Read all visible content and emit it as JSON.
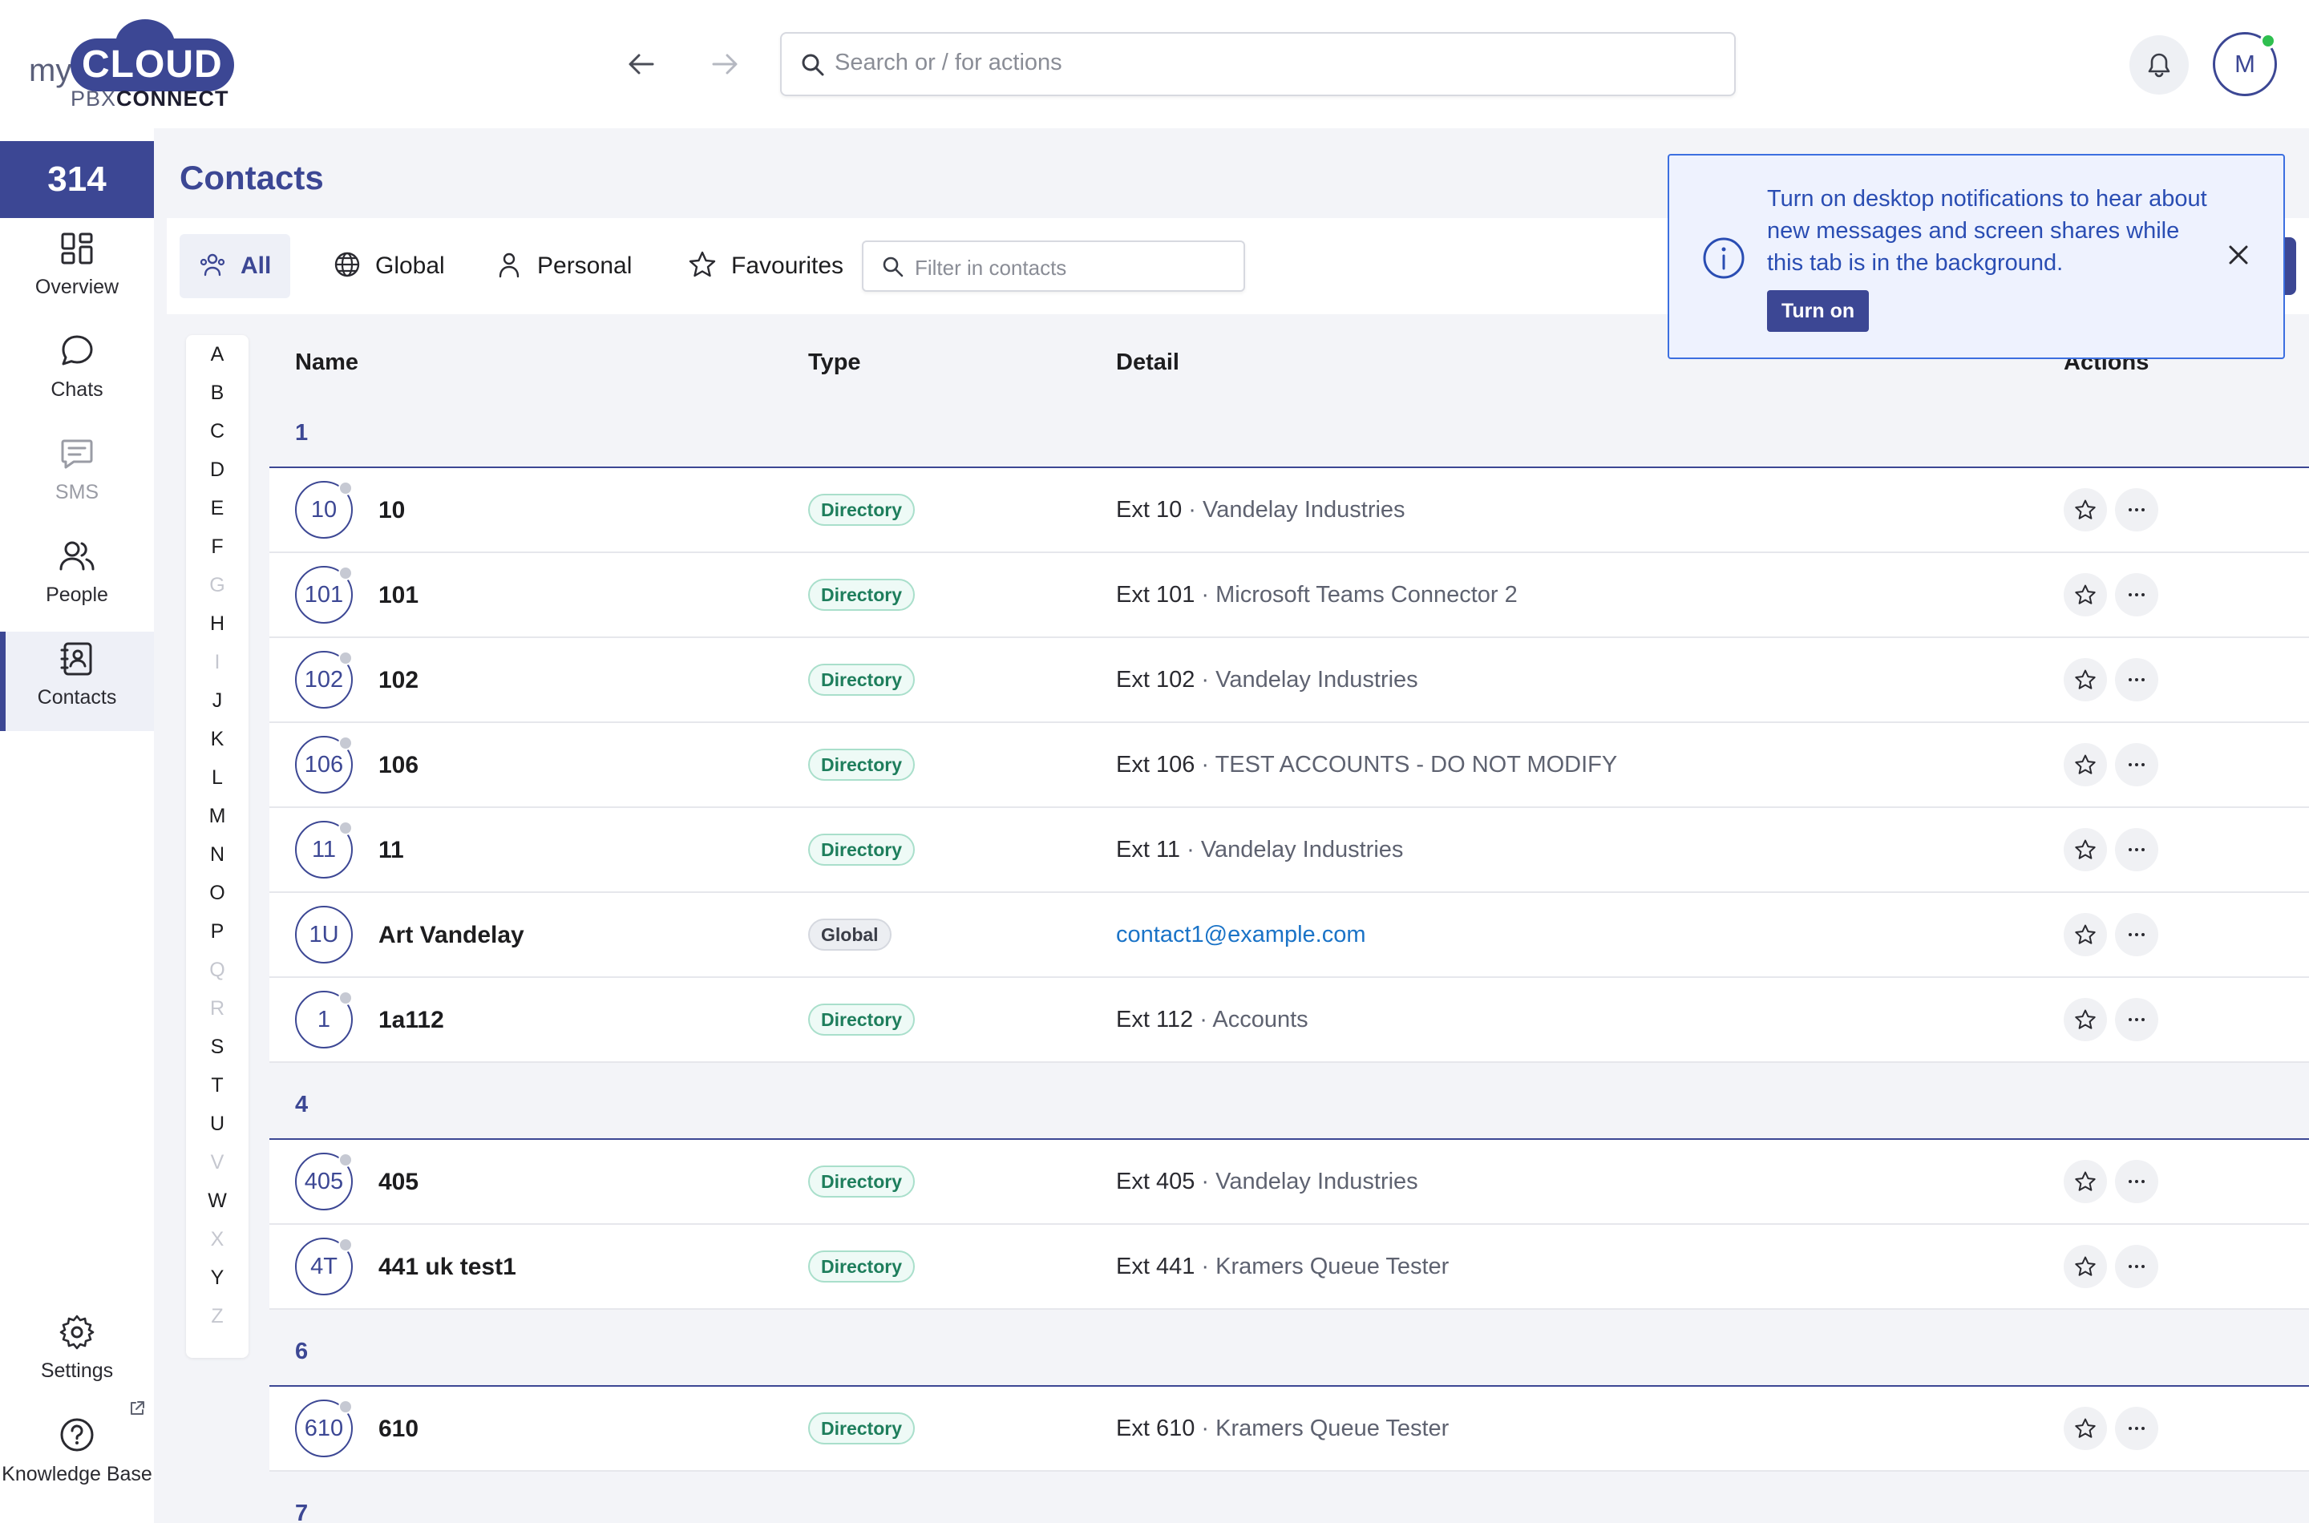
{
  "app": {
    "logo": {
      "my": "my",
      "cloud": "CLOUD",
      "sub_a": "PBX",
      "sub_b": "CONNECT"
    },
    "search_placeholder": "Search or / for actions",
    "user_initial": "M",
    "online_color": "#2fbf4f",
    "accent_color": "#3c4794"
  },
  "sidebar": {
    "count": "314",
    "items": [
      {
        "label": "Overview",
        "icon": "overview-icon"
      },
      {
        "label": "Chats",
        "icon": "chat-bubble-icon"
      },
      {
        "label": "SMS",
        "icon": "sms-icon"
      },
      {
        "label": "People",
        "icon": "people-icon"
      },
      {
        "label": "Contacts",
        "icon": "contacts-book-icon"
      }
    ],
    "settings": "Settings",
    "knowledge_base": "Knowledge Base"
  },
  "page": {
    "title": "Contacts",
    "tabs": [
      {
        "label": "All",
        "icon": "all-people-icon"
      },
      {
        "label": "Global",
        "icon": "globe-icon"
      },
      {
        "label": "Personal",
        "icon": "person-icon"
      },
      {
        "label": "Favourites",
        "icon": "star-icon"
      }
    ],
    "filter_placeholder": "Filter in contacts"
  },
  "alphabet": [
    "A",
    "B",
    "C",
    "D",
    "E",
    "F",
    "G",
    "H",
    "I",
    "J",
    "K",
    "L",
    "M",
    "N",
    "O",
    "P",
    "Q",
    "R",
    "S",
    "T",
    "U",
    "V",
    "W",
    "X",
    "Y",
    "Z"
  ],
  "alphabet_dimmed": [
    "G",
    "I",
    "Q",
    "R",
    "V",
    "X",
    "Z"
  ],
  "table": {
    "headers": {
      "name": "Name",
      "type": "Type",
      "detail": "Detail",
      "actions": "Actions"
    },
    "groups": [
      {
        "label": "1",
        "rows": [
          {
            "avatar": "10",
            "name": "10",
            "type": "Directory",
            "ext": "Ext 10",
            "org": "Vandelay Industries"
          },
          {
            "avatar": "101",
            "name": "101",
            "type": "Directory",
            "ext": "Ext 101",
            "org": "Microsoft Teams Connector 2"
          },
          {
            "avatar": "102",
            "name": "102",
            "type": "Directory",
            "ext": "Ext 102",
            "org": "Vandelay Industries"
          },
          {
            "avatar": "106",
            "name": "106",
            "type": "Directory",
            "ext": "Ext 106",
            "org": "TEST ACCOUNTS - DO NOT MODIFY"
          },
          {
            "avatar": "11",
            "name": "11",
            "type": "Directory",
            "ext": "Ext 11",
            "org": "Vandelay Industries"
          },
          {
            "avatar": "1U",
            "name": "Art Vandelay",
            "type": "Global",
            "email": "contact1@example.com"
          },
          {
            "avatar": "1",
            "name": "1a112",
            "type": "Directory",
            "ext": "Ext 112",
            "org": "Accounts"
          }
        ]
      },
      {
        "label": "4",
        "rows": [
          {
            "avatar": "405",
            "name": "405",
            "type": "Directory",
            "ext": "Ext 405",
            "org": "Vandelay Industries"
          },
          {
            "avatar": "4T",
            "name": "441 uk test1",
            "type": "Directory",
            "ext": "Ext 441",
            "org": "Kramers Queue Tester"
          }
        ]
      },
      {
        "label": "6",
        "rows": [
          {
            "avatar": "610",
            "name": "610",
            "type": "Directory",
            "ext": "Ext 610",
            "org": "Kramers Queue Tester"
          }
        ]
      },
      {
        "label": "7",
        "rows": []
      }
    ]
  },
  "notification": {
    "message": "Turn on desktop notifications to hear about new messages and screen shares while this tab is in the background.",
    "button": "Turn on"
  }
}
